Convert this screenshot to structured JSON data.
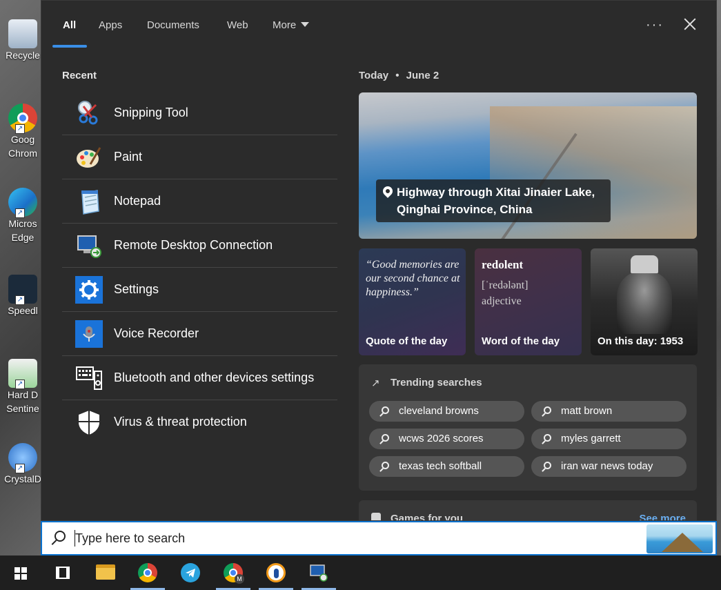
{
  "desktop": {
    "icons": [
      {
        "label": "Recycle",
        "icon": "recycle-bin-icon"
      },
      {
        "label": "Goog Chrom",
        "icon": "chrome-icon"
      },
      {
        "label": "Micros Edge",
        "icon": "edge-icon"
      },
      {
        "label": "Speedl",
        "icon": "app-icon"
      },
      {
        "label": "Hard D Sentine",
        "icon": "hdd-icon"
      },
      {
        "label": "CrystalD",
        "icon": "crystaldisk-icon"
      }
    ]
  },
  "tabs": [
    {
      "label": "All",
      "active": true
    },
    {
      "label": "Apps"
    },
    {
      "label": "Documents"
    },
    {
      "label": "Web"
    },
    {
      "label": "More"
    }
  ],
  "recent": {
    "title": "Recent",
    "items": [
      {
        "label": "Snipping Tool",
        "icon": "scissors-icon"
      },
      {
        "label": "Paint",
        "icon": "paint-palette-icon"
      },
      {
        "label": "Notepad",
        "icon": "notepad-icon"
      },
      {
        "label": "Remote Desktop Connection",
        "icon": "remote-desktop-icon"
      },
      {
        "label": "Settings",
        "icon": "gear-icon"
      },
      {
        "label": "Voice Recorder",
        "icon": "microphone-icon"
      },
      {
        "label": "Bluetooth and other devices settings",
        "icon": "keyboard-speaker-icon"
      },
      {
        "label": "Virus & threat protection",
        "icon": "shield-icon"
      }
    ]
  },
  "today": {
    "title": "Today",
    "date": "June 2",
    "hero_caption": "Highway through Xitai Jinaier Lake, Qinghai Province, China"
  },
  "cards": {
    "quote": {
      "text": "“Good memories are our second chance at happiness.”",
      "label": "Quote of the day"
    },
    "word": {
      "word": "redolent",
      "phonetic": "[ˈredələnt]",
      "part_of_speech": "adjective",
      "label": "Word of the day"
    },
    "history": {
      "label": "On this day: 1953"
    }
  },
  "trending": {
    "title": "Trending searches",
    "items": [
      "cleveland browns",
      "matt brown",
      "wcws 2026 scores",
      "myles garrett",
      "texas tech softball",
      "iran war news today"
    ]
  },
  "games": {
    "title": "Games for you",
    "see_more": "See more"
  },
  "search": {
    "placeholder": "Type here to search"
  },
  "taskbar": {
    "items": [
      "windows-start-icon",
      "task-view-icon",
      "file-explorer-icon",
      "chrome-icon",
      "telegram-icon",
      "chrome-profile-icon",
      "vpn-icon",
      "remote-desktop-icon"
    ]
  },
  "colors": {
    "accent": "#3a8ee6",
    "panel_bg": "#2b2b2b",
    "search_border": "#0a72cf"
  }
}
